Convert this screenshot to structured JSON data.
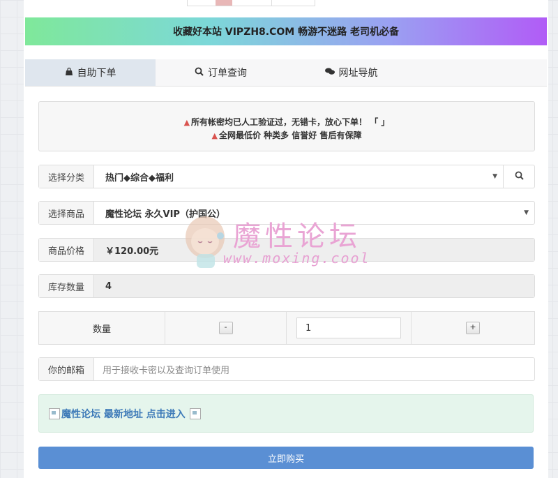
{
  "banner": {
    "text": "收藏好本站 VIPZH8.COM 畅游不迷路 老司机必备"
  },
  "tabs": [
    {
      "label": "自助下单",
      "icon": "bag-icon"
    },
    {
      "label": "订单查询",
      "icon": "search-icon"
    },
    {
      "label": "网址导航",
      "icon": "chat-icon"
    }
  ],
  "notice": {
    "line1": "所有帐密均已人工验证过，无错卡，放心下单！ 「 」",
    "line2": "全网最低价 种类多 信誉好 售后有保障"
  },
  "form": {
    "category": {
      "label": "选择分类",
      "value": "热门◆综合◆福利"
    },
    "product": {
      "label": "选择商品",
      "value": "魔性论坛 永久VIP（护国公）"
    },
    "price": {
      "label": "商品价格",
      "value": "￥120.00元"
    },
    "stock": {
      "label": "库存数量",
      "value": "4"
    },
    "quantity": {
      "label": "数量",
      "value": "1",
      "minus": "-",
      "plus": "+"
    },
    "email": {
      "label": "你的邮箱",
      "placeholder": "用于接收卡密以及查询订单使用"
    }
  },
  "link_box": {
    "text": "魔性论坛 最新地址 点击进入"
  },
  "buy_button": {
    "label": "立即购买"
  },
  "watermark": {
    "title": "魔性论坛",
    "url": "www.moxing.cool"
  },
  "colors": {
    "buy_button": "#5a8fd4",
    "link_text": "#3d7ab8",
    "warning": "#d9534f"
  }
}
